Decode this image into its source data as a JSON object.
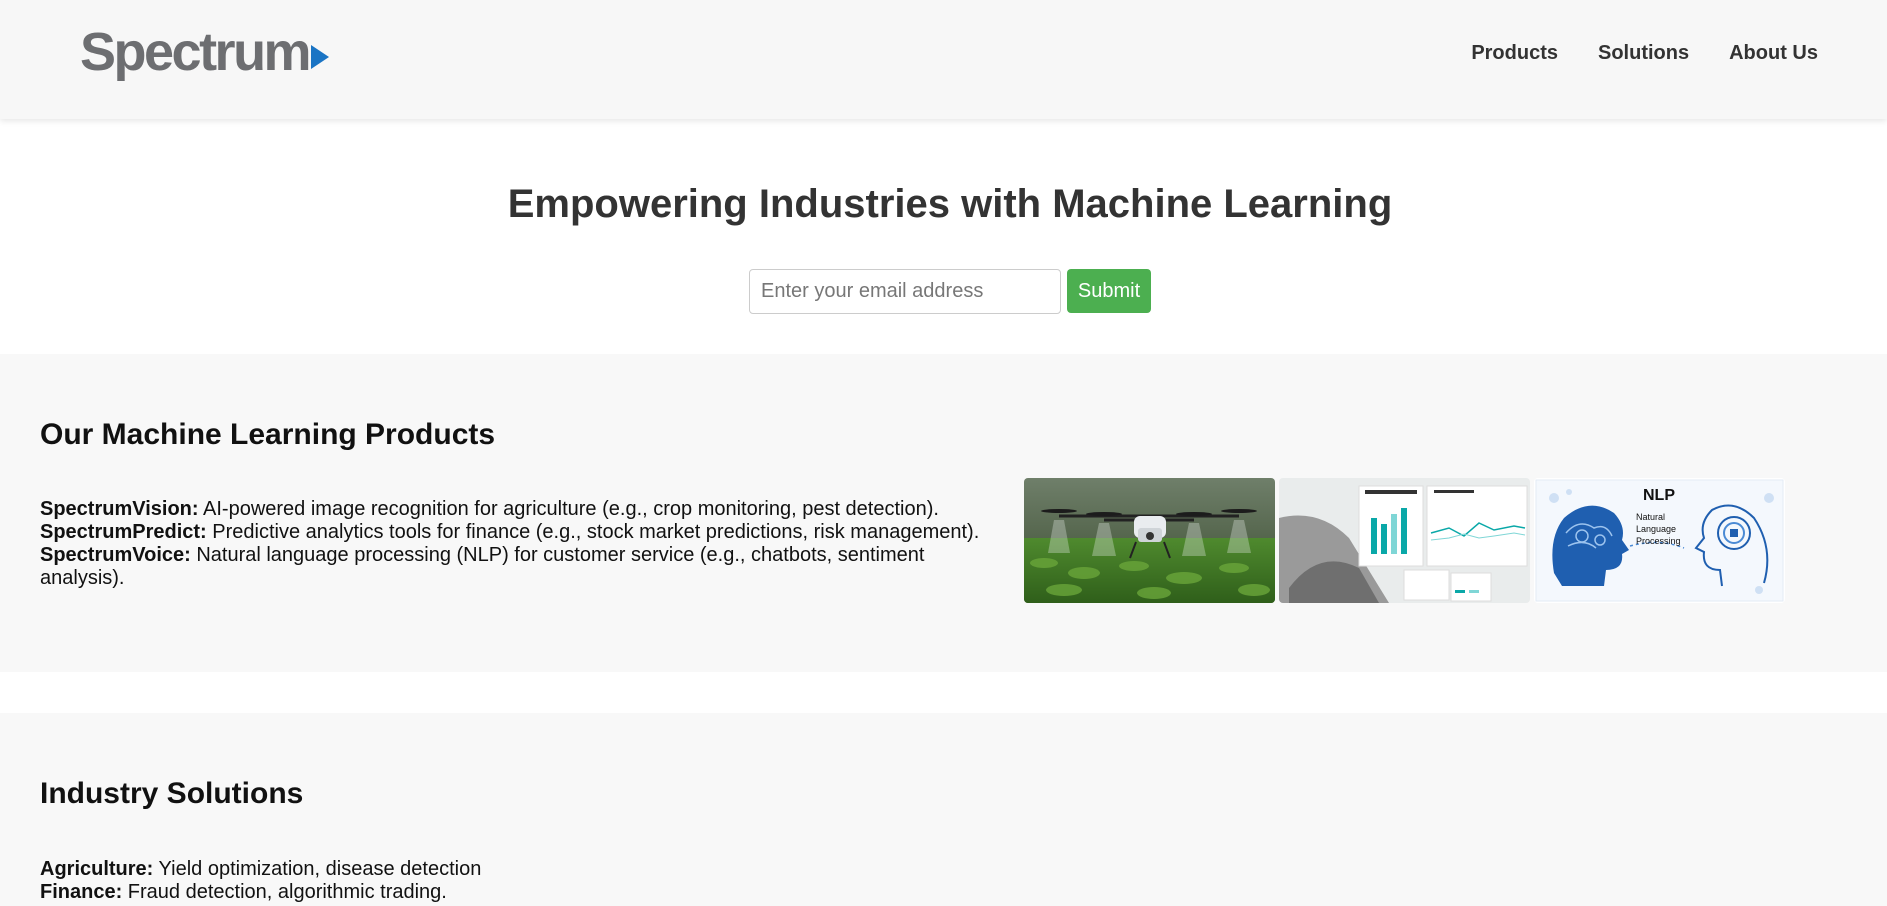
{
  "header": {
    "logo_text": "Spectrum",
    "nav": [
      {
        "label": "Products"
      },
      {
        "label": "Solutions"
      },
      {
        "label": "About Us"
      }
    ]
  },
  "hero": {
    "title": "Empowering Industries with Machine Learning",
    "email_placeholder": "Enter your email address",
    "submit_label": "Submit"
  },
  "products": {
    "heading": "Our Machine Learning Products",
    "items": [
      {
        "name": "SpectrumVision:",
        "text": " AI-powered image recognition for agriculture (e.g., crop monitoring, pest detection)."
      },
      {
        "name": "SpectrumPredict:",
        "text": " Predictive analytics tools for finance (e.g., stock market predictions, risk management)."
      },
      {
        "name": "SpectrumVoice:",
        "text": " Natural language processing (NLP) for customer service (e.g., chatbots, sentiment analysis)."
      }
    ],
    "images": [
      {
        "name": "agriculture-drone-image"
      },
      {
        "name": "analytics-dashboard-image"
      },
      {
        "name": "nlp-illustration-image",
        "caption_title": "NLP",
        "caption_lines": [
          "Natural",
          "Language",
          "Processing"
        ]
      }
    ]
  },
  "solutions": {
    "heading": "Industry Solutions",
    "items": [
      {
        "name": "Agriculture:",
        "text": " Yield optimization, disease detection"
      },
      {
        "name": "Finance:",
        "text": " Fraud detection, algorithmic trading."
      }
    ]
  },
  "colors": {
    "accent_green": "#4caf50",
    "logo_gray": "#6d6e71",
    "logo_blue": "#1a74c4"
  }
}
